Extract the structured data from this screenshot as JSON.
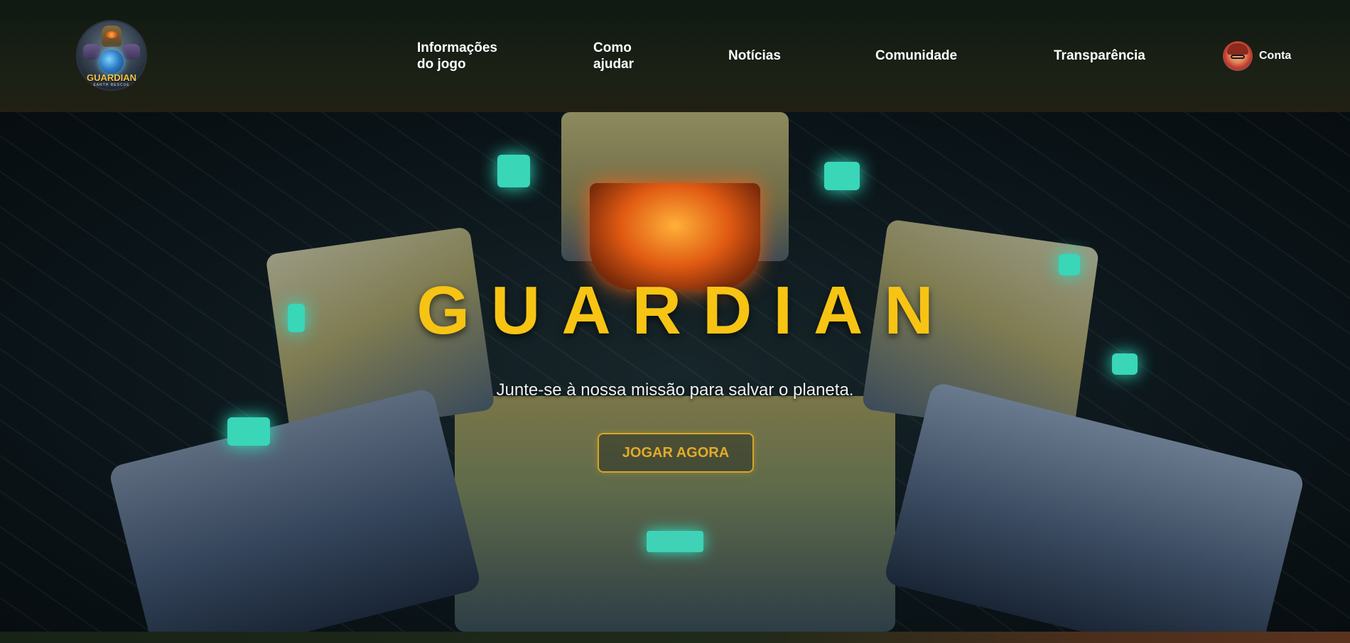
{
  "header": {
    "logo": {
      "title": "GUARDIAN",
      "subtitle": "EARTH RESCUE"
    },
    "nav": [
      {
        "label": "Informações do jogo"
      },
      {
        "label": "Como ajudar"
      },
      {
        "label": "Notícias"
      },
      {
        "label": "Comunidade"
      },
      {
        "label": "Transparência"
      }
    ],
    "account": {
      "label": "Conta",
      "icon": "avatar-icon"
    }
  },
  "hero": {
    "title": "GUARDIAN",
    "subtitle": "Junte-se à nossa missão para salvar o planeta.",
    "cta_label": "JOGAR AGORA"
  },
  "colors": {
    "accent_yellow": "#f7c414",
    "cta_gold": "#e2ab2a",
    "header_bg": "#1c2115"
  }
}
